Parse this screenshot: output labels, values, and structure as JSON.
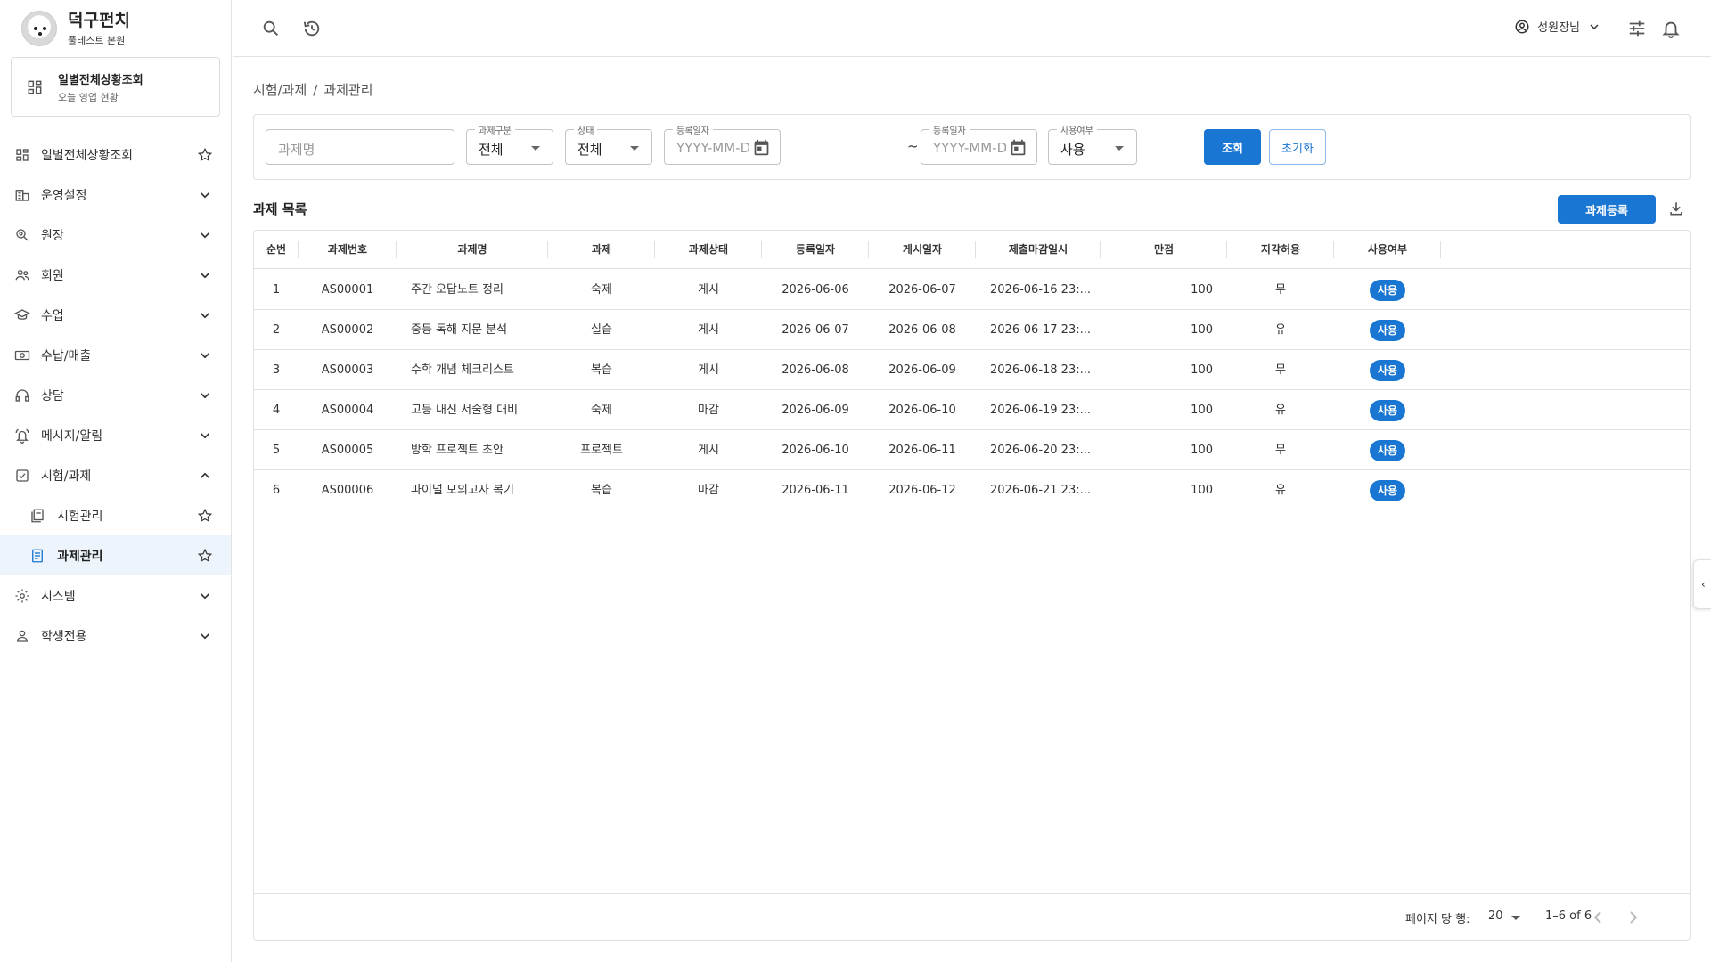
{
  "brand": {
    "title": "덕구펀치",
    "subtitle": "풀테스트 본원"
  },
  "today_card": {
    "title": "일별전체상황조회",
    "subtitle": "오늘 영업 현황"
  },
  "nav": [
    {
      "label": "일별전체상황조회",
      "icon": "dashboard-icon",
      "trail": "star"
    },
    {
      "label": "운영설정",
      "icon": "building-icon",
      "trail": "chevron-down"
    },
    {
      "label": "원장",
      "icon": "director-icon",
      "trail": "chevron-down"
    },
    {
      "label": "회원",
      "icon": "members-icon",
      "trail": "chevron-down"
    },
    {
      "label": "수업",
      "icon": "graduation-cap-icon",
      "trail": "chevron-down"
    },
    {
      "label": "수납/매출",
      "icon": "payment-icon",
      "trail": "chevron-down"
    },
    {
      "label": "상담",
      "icon": "headset-icon",
      "trail": "chevron-down"
    },
    {
      "label": "메시지/알림",
      "icon": "bell-ring-icon",
      "trail": "chevron-down"
    },
    {
      "label": "시험/과제",
      "icon": "checkbox-icon",
      "trail": "chevron-up"
    },
    {
      "label": "시험관리",
      "icon": "exam-icon",
      "trail": "star",
      "sub": true
    },
    {
      "label": "과제관리",
      "icon": "assignment-icon",
      "trail": "star",
      "sub": true,
      "active": true
    },
    {
      "label": "시스템",
      "icon": "gear-icon",
      "trail": "chevron-down"
    },
    {
      "label": "학생전용",
      "icon": "person-icon",
      "trail": "chevron-down"
    }
  ],
  "topbar": {
    "user_name": "성원장님"
  },
  "breadcrumb": {
    "parent": "시험/과제",
    "separator": "/",
    "current": "과제관리"
  },
  "filter": {
    "name_placeholder": "과제명",
    "type_label": "과제구분",
    "type_value": "전체",
    "status_label": "상태",
    "status_value": "전체",
    "date_from_label": "등록일자",
    "date_from_placeholder": "YYYY-MM-DD",
    "tilde": "~",
    "date_to_label": "등록일자",
    "date_to_placeholder": "YYYY-MM-DD",
    "use_label": "사용여부",
    "use_value": "사용",
    "search_label": "조회",
    "reset_label": "초기화"
  },
  "list": {
    "title": "과제 목록",
    "add_label": "과제등록"
  },
  "table": {
    "headers": [
      "순번",
      "과제번호",
      "과제명",
      "과제",
      "과제상태",
      "등록일자",
      "게시일자",
      "제출마감일시",
      "만점",
      "지각허용",
      "사용여부"
    ],
    "rows": [
      [
        "1",
        "AS00001",
        "주간 오답노트 정리",
        "숙제",
        "게시",
        "2026-06-06",
        "2026-06-07",
        "2026-06-16 23:...",
        "100",
        "무",
        "사용"
      ],
      [
        "2",
        "AS00002",
        "중등 독해 지문 분석",
        "실습",
        "게시",
        "2026-06-07",
        "2026-06-08",
        "2026-06-17 23:...",
        "100",
        "유",
        "사용"
      ],
      [
        "3",
        "AS00003",
        "수학 개념 체크리스트",
        "복습",
        "게시",
        "2026-06-08",
        "2026-06-09",
        "2026-06-18 23:...",
        "100",
        "무",
        "사용"
      ],
      [
        "4",
        "AS00004",
        "고등 내신 서술형 대비",
        "숙제",
        "마감",
        "2026-06-09",
        "2026-06-10",
        "2026-06-19 23:...",
        "100",
        "유",
        "사용"
      ],
      [
        "5",
        "AS00005",
        "방학 프로젝트 초안",
        "프로젝트",
        "게시",
        "2026-06-10",
        "2026-06-11",
        "2026-06-20 23:...",
        "100",
        "무",
        "사용"
      ],
      [
        "6",
        "AS00006",
        "파이널 모의고사 복기",
        "복습",
        "마감",
        "2026-06-11",
        "2026-06-12",
        "2026-06-21 23:...",
        "100",
        "유",
        "사용"
      ]
    ]
  },
  "pagination": {
    "rows_per_page_label": "페이지 당 행:",
    "rows_per_page": "20",
    "range": "1–6 of 6"
  },
  "side_tab": {
    "glyph": "‹"
  },
  "colors": {
    "primary": "#1976d2",
    "active_bg": "#eef4fb"
  }
}
